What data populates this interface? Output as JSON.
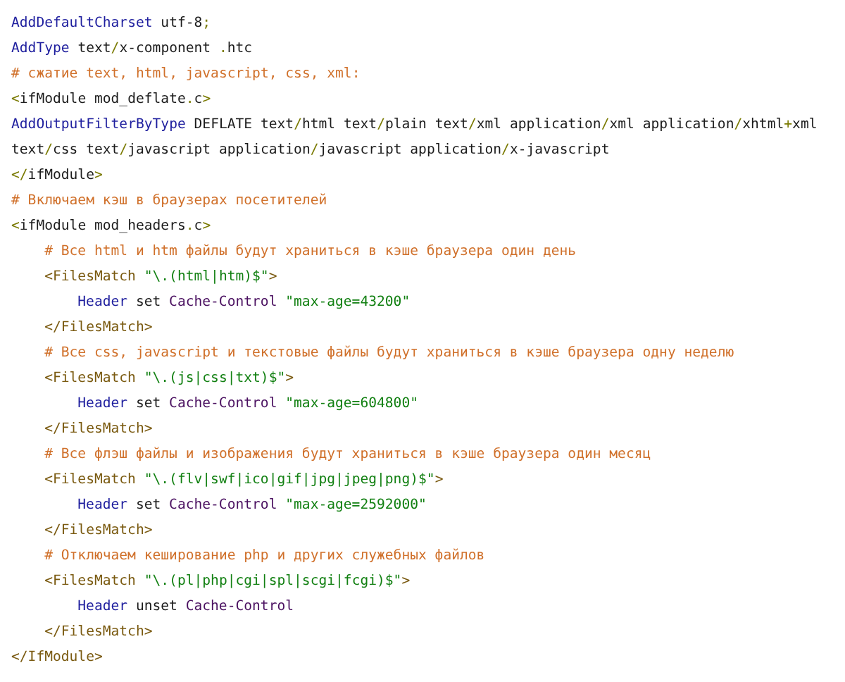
{
  "lines": [
    {
      "tokens": [
        {
          "kind": "dir",
          "text": "AddDefaultCharset"
        },
        {
          "kind": "plain",
          "text": " utf-8"
        },
        {
          "kind": "punct",
          "text": ";"
        }
      ]
    },
    {
      "tokens": [
        {
          "kind": "dir",
          "text": "AddType"
        },
        {
          "kind": "plain",
          "text": " text"
        },
        {
          "kind": "punct",
          "text": "/"
        },
        {
          "kind": "plain",
          "text": "x-component "
        },
        {
          "kind": "punct",
          "text": "."
        },
        {
          "kind": "plain",
          "text": "htc"
        }
      ]
    },
    {
      "tokens": [
        {
          "kind": "comment",
          "text": "# сжатие text, html, javascript, css, xml:"
        }
      ]
    },
    {
      "tokens": [
        {
          "kind": "punct",
          "text": "<"
        },
        {
          "kind": "plain",
          "text": "ifModule mod_deflate"
        },
        {
          "kind": "punct",
          "text": "."
        },
        {
          "kind": "plain",
          "text": "c"
        },
        {
          "kind": "punct",
          "text": ">"
        }
      ]
    },
    {
      "tokens": [
        {
          "kind": "dir",
          "text": "AddOutputFilterByType"
        },
        {
          "kind": "plain",
          "text": " DEFLATE text"
        },
        {
          "kind": "punct",
          "text": "/"
        },
        {
          "kind": "plain",
          "text": "html text"
        },
        {
          "kind": "punct",
          "text": "/"
        },
        {
          "kind": "plain",
          "text": "plain text"
        },
        {
          "kind": "punct",
          "text": "/"
        },
        {
          "kind": "plain",
          "text": "xml application"
        },
        {
          "kind": "punct",
          "text": "/"
        },
        {
          "kind": "plain",
          "text": "xml application"
        },
        {
          "kind": "punct",
          "text": "/"
        },
        {
          "kind": "plain",
          "text": "xhtml"
        },
        {
          "kind": "punct",
          "text": "+"
        },
        {
          "kind": "plain",
          "text": "xml"
        }
      ]
    },
    {
      "tokens": [
        {
          "kind": "plain",
          "text": "text"
        },
        {
          "kind": "punct",
          "text": "/"
        },
        {
          "kind": "plain",
          "text": "css text"
        },
        {
          "kind": "punct",
          "text": "/"
        },
        {
          "kind": "plain",
          "text": "javascript application"
        },
        {
          "kind": "punct",
          "text": "/"
        },
        {
          "kind": "plain",
          "text": "javascript application"
        },
        {
          "kind": "punct",
          "text": "/"
        },
        {
          "kind": "plain",
          "text": "x-javascript"
        }
      ]
    },
    {
      "tokens": [
        {
          "kind": "punct",
          "text": "</"
        },
        {
          "kind": "plain",
          "text": "ifModule"
        },
        {
          "kind": "punct",
          "text": ">"
        }
      ]
    },
    {
      "tokens": [
        {
          "kind": "comment",
          "text": "# Включаем кэш в браузерах посетителей"
        }
      ]
    },
    {
      "tokens": [
        {
          "kind": "punct",
          "text": "<"
        },
        {
          "kind": "plain",
          "text": "ifModule mod_headers"
        },
        {
          "kind": "punct",
          "text": "."
        },
        {
          "kind": "plain",
          "text": "c"
        },
        {
          "kind": "punct",
          "text": ">"
        }
      ],
      "children": [
        {
          "tokens": [
            {
              "kind": "comment",
              "text": "# Все html и htm файлы будут храниться в кэше браузера один день"
            }
          ]
        },
        {
          "tokens": [
            {
              "kind": "tag",
              "text": "<FilesMatch "
            },
            {
              "kind": "string",
              "text": "\"\\.(html|htm)$\""
            },
            {
              "kind": "tag",
              "text": ">"
            }
          ],
          "children": [
            {
              "tokens": [
                {
                  "kind": "dir",
                  "text": "Header"
                },
                {
                  "kind": "plain",
                  "text": " set "
                },
                {
                  "kind": "name",
                  "text": "Cache-Control "
                },
                {
                  "kind": "string",
                  "text": "\"max-age=43200\""
                }
              ]
            }
          ]
        },
        {
          "tokens": [
            {
              "kind": "tag",
              "text": "</FilesMatch>"
            }
          ]
        },
        {
          "tokens": [
            {
              "kind": "comment",
              "text": "# Все css, javascript и текстовые файлы будут храниться в кэше браузера одну неделю"
            }
          ]
        },
        {
          "tokens": [
            {
              "kind": "tag",
              "text": "<FilesMatch "
            },
            {
              "kind": "string",
              "text": "\"\\.(js|css|txt)$\""
            },
            {
              "kind": "tag",
              "text": ">"
            }
          ],
          "children": [
            {
              "tokens": [
                {
                  "kind": "dir",
                  "text": "Header"
                },
                {
                  "kind": "plain",
                  "text": " set "
                },
                {
                  "kind": "name",
                  "text": "Cache-Control "
                },
                {
                  "kind": "string",
                  "text": "\"max-age=604800\""
                }
              ]
            }
          ]
        },
        {
          "tokens": [
            {
              "kind": "tag",
              "text": "</FilesMatch>"
            }
          ]
        },
        {
          "tokens": [
            {
              "kind": "comment",
              "text": "# Все флэш файлы и изображения будут храниться в кэше браузера один месяц"
            }
          ]
        },
        {
          "tokens": [
            {
              "kind": "tag",
              "text": "<FilesMatch "
            },
            {
              "kind": "string",
              "text": "\"\\.(flv|swf|ico|gif|jpg|jpeg|png)$\""
            },
            {
              "kind": "tag",
              "text": ">"
            }
          ],
          "children": [
            {
              "tokens": [
                {
                  "kind": "dir",
                  "text": "Header"
                },
                {
                  "kind": "plain",
                  "text": " set "
                },
                {
                  "kind": "name",
                  "text": "Cache-Control "
                },
                {
                  "kind": "string",
                  "text": "\"max-age=2592000\""
                }
              ]
            }
          ]
        },
        {
          "tokens": [
            {
              "kind": "tag",
              "text": "</FilesMatch>"
            }
          ]
        },
        {
          "tokens": [
            {
              "kind": "comment",
              "text": "# Отключаем кеширование php и других служебных файлов"
            }
          ]
        },
        {
          "tokens": [
            {
              "kind": "tag",
              "text": "<FilesMatch "
            },
            {
              "kind": "string",
              "text": "\"\\.(pl|php|cgi|spl|scgi|fcgi)$\""
            },
            {
              "kind": "tag",
              "text": ">"
            }
          ],
          "children": [
            {
              "tokens": [
                {
                  "kind": "dir",
                  "text": "Header"
                },
                {
                  "kind": "plain",
                  "text": " unset "
                },
                {
                  "kind": "name",
                  "text": "Cache-Control"
                }
              ]
            }
          ]
        },
        {
          "tokens": [
            {
              "kind": "tag",
              "text": "</FilesMatch>"
            }
          ]
        }
      ]
    },
    {
      "tokens": [
        {
          "kind": "tag",
          "text": "</IfModule>"
        }
      ]
    }
  ]
}
